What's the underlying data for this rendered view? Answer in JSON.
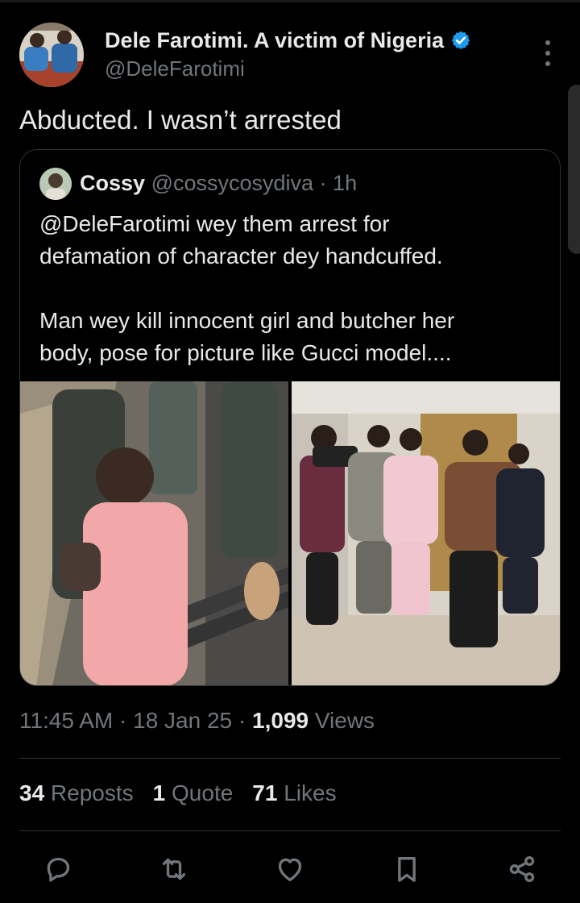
{
  "author": {
    "display_name": "Dele Farotimi. A victim of Nigeria",
    "handle": "@DeleFarotimi",
    "verified": true
  },
  "tweet": {
    "text": "Abducted. I wasn’t arrested"
  },
  "quoted": {
    "name": "Cossy",
    "handle": "@cossycosydiva",
    "sep": " · ",
    "age": "1h",
    "paragraph1": [
      "@DeleFarotimi wey them arrest for",
      "defamation of character dey handcuffed."
    ],
    "paragraph2": [
      "Man wey kill innocent girl and butcher her",
      "body, pose for picture like Gucci model...."
    ]
  },
  "meta": {
    "time": "11:45 AM",
    "sep1": " · ",
    "date": "18 Jan 25",
    "sep2": " · ",
    "views_count": "1,099",
    "views_label": " Views"
  },
  "stats": {
    "reposts_count": "34",
    "reposts_label": " Reposts",
    "quotes_count": "1",
    "quotes_label": " Quote",
    "likes_count": "71",
    "likes_label": " Likes"
  },
  "actions": [
    "reply-icon",
    "repost-icon",
    "like-icon",
    "bookmark-icon",
    "share-icon"
  ],
  "colors": {
    "background": "#000000",
    "text": "#e7e9ea",
    "secondary": "#71767b",
    "border": "#2f3336",
    "verified": "#1d9bf0"
  }
}
